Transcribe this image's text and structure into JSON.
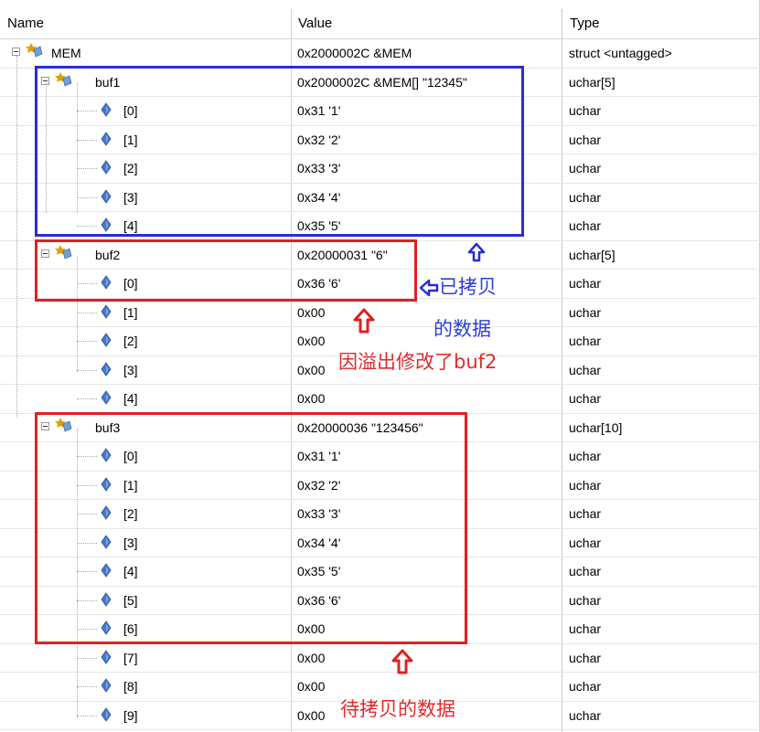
{
  "columns": {
    "name": "Name",
    "value": "Value",
    "type": "Type"
  },
  "rows": [
    {
      "name": "MEM",
      "value": "0x2000002C &MEM",
      "type": "struct <untagged>",
      "kind": "struct",
      "depth": 0,
      "expanded": true
    },
    {
      "name": "buf1",
      "value": "0x2000002C &MEM[] \"12345\"",
      "type": "uchar[5]",
      "kind": "struct",
      "depth": 1,
      "expanded": true
    },
    {
      "name": "[0]",
      "value": "0x31 '1'",
      "type": "uchar",
      "kind": "member",
      "depth": 2
    },
    {
      "name": "[1]",
      "value": "0x32 '2'",
      "type": "uchar",
      "kind": "member",
      "depth": 2
    },
    {
      "name": "[2]",
      "value": "0x33 '3'",
      "type": "uchar",
      "kind": "member",
      "depth": 2
    },
    {
      "name": "[3]",
      "value": "0x34 '4'",
      "type": "uchar",
      "kind": "member",
      "depth": 2
    },
    {
      "name": "[4]",
      "value": "0x35 '5'",
      "type": "uchar",
      "kind": "member",
      "depth": 2
    },
    {
      "name": "buf2",
      "value": "0x20000031 \"6\"",
      "type": "uchar[5]",
      "kind": "struct",
      "depth": 1,
      "expanded": true
    },
    {
      "name": "[0]",
      "value": "0x36 '6'",
      "type": "uchar",
      "kind": "member",
      "depth": 2
    },
    {
      "name": "[1]",
      "value": "0x00",
      "type": "uchar",
      "kind": "member",
      "depth": 2
    },
    {
      "name": "[2]",
      "value": "0x00",
      "type": "uchar",
      "kind": "member",
      "depth": 2
    },
    {
      "name": "[3]",
      "value": "0x00",
      "type": "uchar",
      "kind": "member",
      "depth": 2
    },
    {
      "name": "[4]",
      "value": "0x00",
      "type": "uchar",
      "kind": "member",
      "depth": 2
    },
    {
      "name": "buf3",
      "value": "0x20000036 \"123456\"",
      "type": "uchar[10]",
      "kind": "struct",
      "depth": 1,
      "expanded": true
    },
    {
      "name": "[0]",
      "value": "0x31 '1'",
      "type": "uchar",
      "kind": "member",
      "depth": 2
    },
    {
      "name": "[1]",
      "value": "0x32 '2'",
      "type": "uchar",
      "kind": "member",
      "depth": 2
    },
    {
      "name": "[2]",
      "value": "0x33 '3'",
      "type": "uchar",
      "kind": "member",
      "depth": 2
    },
    {
      "name": "[3]",
      "value": "0x34 '4'",
      "type": "uchar",
      "kind": "member",
      "depth": 2
    },
    {
      "name": "[4]",
      "value": "0x35 '5'",
      "type": "uchar",
      "kind": "member",
      "depth": 2
    },
    {
      "name": "[5]",
      "value": "0x36 '6'",
      "type": "uchar",
      "kind": "member",
      "depth": 2
    },
    {
      "name": "[6]",
      "value": "0x00",
      "type": "uchar",
      "kind": "member",
      "depth": 2
    },
    {
      "name": "[7]",
      "value": "0x00",
      "type": "uchar",
      "kind": "member",
      "depth": 2
    },
    {
      "name": "[8]",
      "value": "0x00",
      "type": "uchar",
      "kind": "member",
      "depth": 2
    },
    {
      "name": "[9]",
      "value": "0x00",
      "type": "uchar",
      "kind": "member",
      "depth": 2
    }
  ],
  "annotations": {
    "copied_line1": "已拷贝",
    "copied_line2": "的数据",
    "overflow": "因溢出修改了buf2",
    "to_copy": "待拷贝的数据"
  },
  "colors": {
    "blue_box": "#2b2bd6",
    "red_box": "#e02020",
    "blue_text": "#2b3fd8",
    "red_text": "#e02a2a"
  }
}
